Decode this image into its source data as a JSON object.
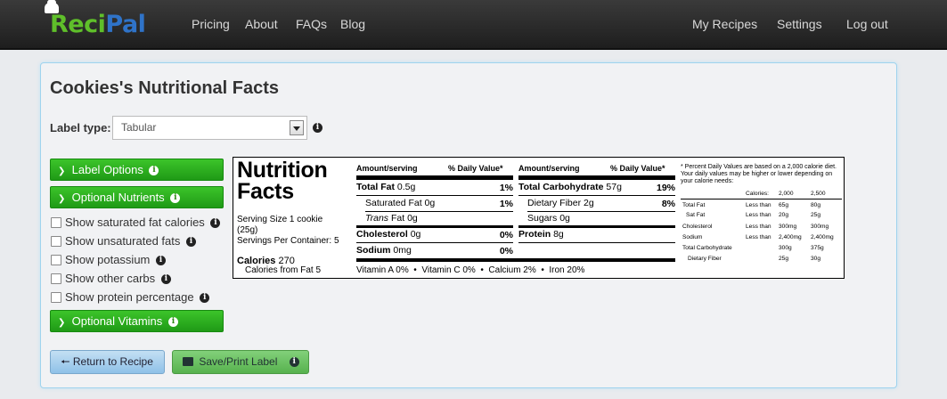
{
  "brand": {
    "reci": "Reci",
    "pal": "Pal"
  },
  "nav": {
    "left": [
      "Pricing",
      "About",
      "FAQs",
      "Blog"
    ],
    "right": [
      "My Recipes",
      "Settings",
      "Log out"
    ]
  },
  "page": {
    "title": "Cookies's Nutritional Facts"
  },
  "label_type": {
    "label": "Label type:",
    "value": "Tabular"
  },
  "sidebar": {
    "label_options": "Label Options",
    "optional_nutrients": "Optional Nutrients",
    "options": [
      "Show saturated fat calories",
      "Show unsaturated fats",
      "Show potassium",
      "Show other carbs",
      "Show protein percentage"
    ],
    "optional_vitamins": "Optional Vitamins"
  },
  "buttons": {
    "return": "Return to Recipe",
    "print": "Save/Print Label"
  },
  "label": {
    "title1": "Nutrition",
    "title2": "Facts",
    "serving1": "Serving Size 1 cookie",
    "serving2": "(25g)",
    "servings": "Servings Per Container: 5",
    "calories_label": "Calories",
    "calories_value": "270",
    "cal_fat": "Calories from Fat 5",
    "amount_hdr": "Amount/serving",
    "dv_hdr": "% Daily Value*",
    "left": [
      {
        "name": "Total Fat",
        "amt": "0.5g",
        "pct": "1%"
      },
      {
        "name": "Saturated Fat",
        "amt": "0g",
        "pct": "1%"
      },
      {
        "name": "Trans",
        "amt": "Fat 0g",
        "pct": ""
      },
      {
        "name": "Cholesterol",
        "amt": "0g",
        "pct": "0%"
      },
      {
        "name": "Sodium",
        "amt": "0mg",
        "pct": "0%"
      }
    ],
    "right": [
      {
        "name": "Total Carbohydrate",
        "amt": "57g",
        "pct": "19%"
      },
      {
        "name": "Dietary Fiber",
        "amt": "2g",
        "pct": "8%"
      },
      {
        "name": "Sugars",
        "amt": "0g",
        "pct": ""
      },
      {
        "name": "Protein",
        "amt": "8g",
        "pct": ""
      }
    ],
    "vitamins": [
      "Vitamin A 0%",
      "Vitamin C 0%",
      "Calcium 2%",
      "Iron 20%"
    ],
    "footnote": "* Percent Daily Values are based on a 2,000 calorie diet. Your daily values may be higher or lower depending on your calorie needs:",
    "table_head": [
      "Calories:",
      "2,000",
      "2,500"
    ],
    "table": [
      [
        "Total Fat",
        "Less than",
        "65g",
        "80g"
      ],
      [
        "Sat Fat",
        "Less than",
        "20g",
        "25g"
      ],
      [
        "Cholesterol",
        "Less than",
        "300mg",
        "300mg"
      ],
      [
        "Sodium",
        "Less than",
        "2,400mg",
        "2,400mg"
      ],
      [
        "Total Carbohydrate",
        "",
        "300g",
        "375g"
      ],
      [
        "Dietary Fiber",
        "",
        "25g",
        "30g"
      ]
    ]
  }
}
